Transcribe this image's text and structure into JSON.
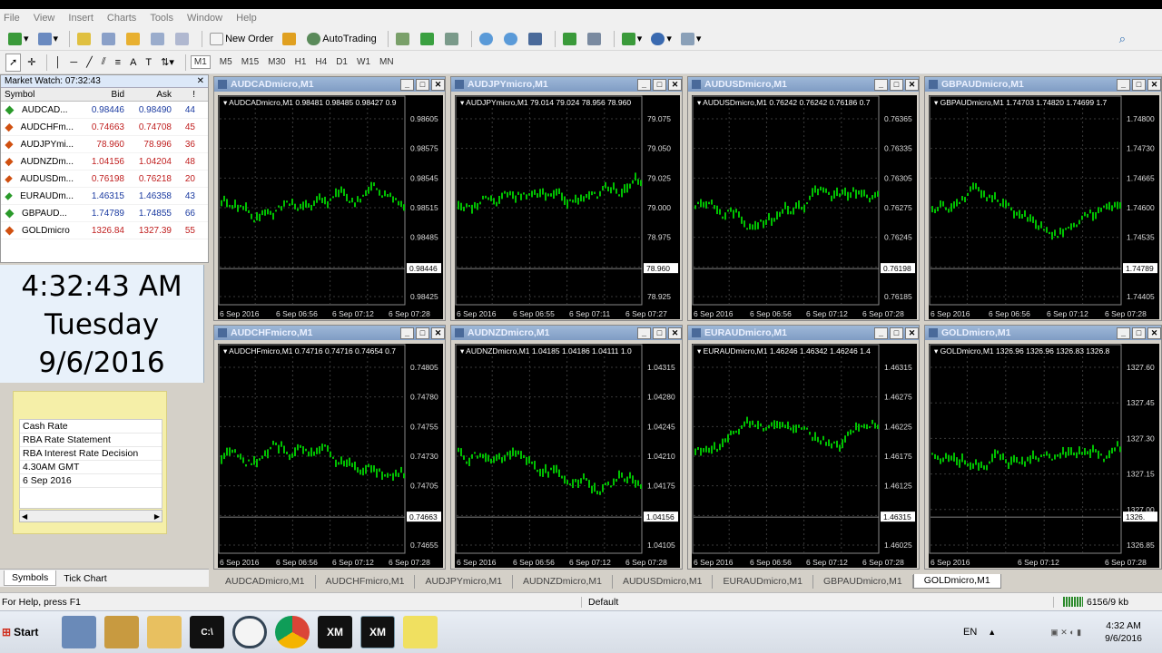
{
  "menu": [
    "File",
    "View",
    "Insert",
    "Charts",
    "Tools",
    "Window",
    "Help"
  ],
  "toolbar": {
    "new_order": "New Order",
    "autotrading": "AutoTrading"
  },
  "timeframes": [
    "M1",
    "M5",
    "M15",
    "M30",
    "H1",
    "H4",
    "D1",
    "W1",
    "MN"
  ],
  "market_watch": {
    "title": "Market Watch: 07:32:43",
    "columns": [
      "Symbol",
      "Bid",
      "Ask",
      "!"
    ],
    "rows": [
      {
        "symbol": "AUDCAD...",
        "bid": "0.98446",
        "ask": "0.98490",
        "spread": "44",
        "dir": "up"
      },
      {
        "symbol": "AUDCHFm...",
        "bid": "0.74663",
        "ask": "0.74708",
        "spread": "45",
        "dir": "down"
      },
      {
        "symbol": "AUDJPYmi...",
        "bid": "78.960",
        "ask": "78.996",
        "spread": "36",
        "dir": "down"
      },
      {
        "symbol": "AUDNZDm...",
        "bid": "1.04156",
        "ask": "1.04204",
        "spread": "48",
        "dir": "down"
      },
      {
        "symbol": "AUDUSDm...",
        "bid": "0.76198",
        "ask": "0.76218",
        "spread": "20",
        "dir": "down"
      },
      {
        "symbol": "EURAUDm...",
        "bid": "1.46315",
        "ask": "1.46358",
        "spread": "43",
        "dir": "up"
      },
      {
        "symbol": "GBPAUD...",
        "bid": "1.74789",
        "ask": "1.74855",
        "spread": "66",
        "dir": "up"
      },
      {
        "symbol": "GOLDmicro",
        "bid": "1326.84",
        "ask": "1327.39",
        "spread": "55",
        "dir": "down"
      }
    ]
  },
  "clock": {
    "time": "4:32:43 AM",
    "day": "Tuesday",
    "date": "9/6/2016"
  },
  "note": [
    "Cash Rate",
    "RBA Rate Statement",
    "RBA Interest Rate Decision",
    "4.30AM GMT",
    "6 Sep 2016"
  ],
  "left_tabs": [
    "Symbols",
    "Tick Chart"
  ],
  "charts": [
    {
      "title": "AUDCADmicro,M1",
      "header": "AUDCADmicro,M1  0.98481 0.98485 0.98427 0.9",
      "yticks": [
        "0.98605",
        "0.98575",
        "0.98545",
        "0.98515",
        "0.98485",
        "0.98455",
        "0.98425"
      ],
      "price_tag": "0.98446",
      "xticks": [
        "6 Sep 2016",
        "6 Sep 06:56",
        "6 Sep 07:12",
        "6 Sep 07:28"
      ]
    },
    {
      "title": "AUDJPYmicro,M1",
      "header": "AUDJPYmicro,M1  79.014 79.024 78.956 78.960",
      "yticks": [
        "79.075",
        "79.050",
        "79.025",
        "79.000",
        "78.975",
        "78.950",
        "78.925"
      ],
      "price_tag": "78.960",
      "xticks": [
        "6 Sep 2016",
        "6 Sep 06:55",
        "6 Sep 07:11",
        "6 Sep 07:27"
      ]
    },
    {
      "title": "AUDUSDmicro,M1",
      "header": "AUDUSDmicro,M1  0.76242 0.76242 0.76186 0.7",
      "yticks": [
        "0.76365",
        "0.76335",
        "0.76305",
        "0.76275",
        "0.76245",
        "0.76215",
        "0.76185"
      ],
      "price_tag": "0.76198",
      "xticks": [
        "6 Sep 2016",
        "6 Sep 06:56",
        "6 Sep 07:12",
        "6 Sep 07:28"
      ]
    },
    {
      "title": "GBPAUDmicro,M1",
      "header": "GBPAUDmicro,M1  1.74703 1.74820 1.74699 1.7",
      "yticks": [
        "1.74800",
        "1.74730",
        "1.74665",
        "1.74600",
        "1.74535",
        "1.74470",
        "1.74405"
      ],
      "price_tag": "1.74789",
      "xticks": [
        "6 Sep 2016",
        "6 Sep 06:56",
        "6 Sep 07:12",
        "6 Sep 07:28"
      ]
    },
    {
      "title": "AUDCHFmicro,M1",
      "header": "AUDCHFmicro,M1  0.74716 0.74716 0.74654 0.7",
      "yticks": [
        "0.74805",
        "0.74780",
        "0.74755",
        "0.74730",
        "0.74705",
        "0.74680",
        "0.74655"
      ],
      "price_tag": "0.74663",
      "xticks": [
        "6 Sep 2016",
        "6 Sep 06:56",
        "6 Sep 07:12",
        "6 Sep 07:28"
      ]
    },
    {
      "title": "AUDNZDmicro,M1",
      "header": "AUDNZDmicro,M1  1.04185 1.04186 1.04111 1.0",
      "yticks": [
        "1.04315",
        "1.04280",
        "1.04245",
        "1.04210",
        "1.04175",
        "1.04140",
        "1.04105"
      ],
      "price_tag": "1.04156",
      "xticks": [
        "6 Sep 2016",
        "6 Sep 06:56",
        "6 Sep 07:12",
        "6 Sep 07:28"
      ]
    },
    {
      "title": "EURAUDmicro,M1",
      "header": "EURAUDmicro,M1  1.46246 1.46342 1.46246 1.4",
      "yticks": [
        "1.46315",
        "1.46275",
        "1.46225",
        "1.46175",
        "1.46125",
        "1.46075",
        "1.46025"
      ],
      "price_tag": "1.46315",
      "xticks": [
        "6 Sep 2016",
        "6 Sep 06:56",
        "6 Sep 07:12",
        "6 Sep 07:28"
      ]
    },
    {
      "title": "GOLDmicro,M1",
      "header": "GOLDmicro,M1  1326.96 1326.96 1326.83 1326.8",
      "yticks": [
        "1327.60",
        "1327.45",
        "1327.30",
        "1327.15",
        "1327.00",
        "1326.85"
      ],
      "price_tag": "1326.",
      "xticks": [
        "6 Sep 2016",
        "6 Sep 07:12",
        "6 Sep 07:28"
      ]
    }
  ],
  "window_tabs": [
    "AUDCADmicro,M1",
    "AUDCHFmicro,M1",
    "AUDJPYmicro,M1",
    "AUDNZDmicro,M1",
    "AUDUSDmicro,M1",
    "EURAUDmicro,M1",
    "GBPAUDmicro,M1",
    "GOLDmicro,M1"
  ],
  "status": {
    "help": "For Help, press F1",
    "profile": "Default",
    "traffic": "6156/9 kb"
  },
  "taskbar": {
    "start": "Start",
    "lang": "EN",
    "time": "4:32 AM",
    "date": "9/6/2016",
    "xm": "XM"
  },
  "colors": {
    "candle": "#00c000",
    "up_arrow": "#2a9a2a",
    "down_arrow": "#d05010"
  }
}
